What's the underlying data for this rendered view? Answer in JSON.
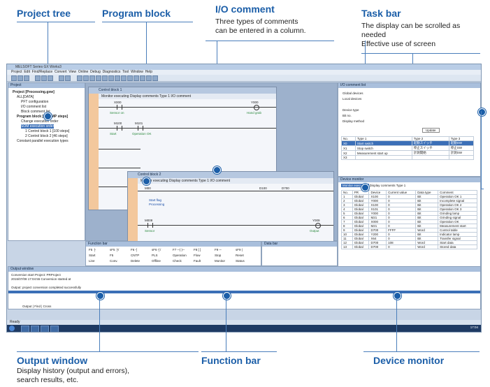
{
  "callouts": {
    "project_tree": {
      "title": "Project tree"
    },
    "program_block": {
      "title": "Program block"
    },
    "io_comment": {
      "title": "I/O comment",
      "desc": [
        "Three types of comments",
        "can be entered in a column."
      ]
    },
    "task_bar": {
      "title": "Task bar",
      "desc": [
        "The display can be scrolled as",
        "needed",
        "Effective use of screen"
      ]
    },
    "output_window": {
      "title": "Output window",
      "desc": [
        "Display history (output and errors),",
        "search results, etc."
      ]
    },
    "function_bar": {
      "title": "Function bar"
    },
    "device_monitor": {
      "title": "Device monitor"
    }
  },
  "screen": {
    "window_title": "MELSOFT Series GX Works3",
    "menu": [
      "Project",
      "Edit",
      "Find/Replace",
      "Convert",
      "View",
      "Online",
      "Debug",
      "Diagnostics",
      "Tool",
      "Window",
      "Help"
    ],
    "project_pane": {
      "header": "Project",
      "items": [
        "Project [Processing.gxw]",
        "ALL[DATA]",
        "PFT configuration",
        "I/O comment list",
        "Block comment list",
        "Program block [PA-SMP steps]",
        "Change execution order",
        "SOM execution order",
        "1 Control block 1 [100 steps]",
        "2 Control block 2 [46 steps]",
        "Constant parallel execution types"
      ],
      "selected_index": 7
    },
    "ladder_back": {
      "tabs": "Control block 1 | Control block 2",
      "title": "Control block 1",
      "controls": "Monitor executing  Display comments  Type 1  I/O comment",
      "labels": [
        "X000",
        "Y000",
        "M100",
        "M101",
        "Sensor on",
        "Hand grab",
        "Start",
        "Operation OK"
      ]
    },
    "ladder_front": {
      "title": "Control block 2",
      "controls": "Monitor executing  Display comments  Type 1  I/O comment",
      "labels": [
        "M00",
        "M008",
        "Y009",
        "D100",
        "D700",
        "Start flag",
        "Processing",
        "Output",
        "Sensor",
        "Stop"
      ]
    },
    "io_comment_pane": {
      "header": "I/O comment list",
      "fields": [
        "Global devices",
        "Local devices",
        "Device type",
        "Bit no.",
        "Display method",
        "Update"
      ],
      "columns": [
        "No.",
        "Type 1",
        "Type 2",
        "Type 3"
      ],
      "rows": [
        [
          "X0",
          "Start switch",
          "起動スイッチ",
          "起動SW"
        ],
        [
          "X1",
          "Stop switch",
          "停止スイッチ",
          "停止SW"
        ],
        [
          "X2",
          "Measurement start up",
          "計測開始",
          "計測SW"
        ],
        [
          "X3",
          "",
          "",
          ""
        ]
      ]
    },
    "device_monitor_pane": {
      "header": "Device monitor",
      "buttons": [
        "Monitor executing",
        "Display comments",
        "Type 1"
      ],
      "columns": [
        "No.",
        "PR",
        "Device",
        "Current value",
        "Data type",
        "Comment"
      ],
      "rows": [
        [
          "1",
          "Global",
          "X100",
          "0",
          "Bit",
          "Operation OK 1"
        ],
        [
          "2",
          "Global",
          "Y000",
          "0",
          "Bit",
          "Incomplete signal"
        ],
        [
          "3",
          "Global",
          "X100",
          "0",
          "Bit",
          "Operation OK 2"
        ],
        [
          "4",
          "Global",
          "X101",
          "0",
          "Bit",
          "Operation OK 3"
        ],
        [
          "5",
          "Global",
          "Y000",
          "0",
          "Bit",
          "Grinding lamp"
        ],
        [
          "6",
          "Global",
          "M21",
          "0",
          "Bit",
          "Grinding signal"
        ],
        [
          "7",
          "Global",
          "X000",
          "0",
          "Bit",
          "Operation OK"
        ],
        [
          "8",
          "Global",
          "M21",
          "0",
          "Bit",
          "Measurement start"
        ],
        [
          "9",
          "Global",
          "D700",
          "FFFF",
          "Word",
          "Control table"
        ],
        [
          "10",
          "Global",
          "Y200",
          "0",
          "Bit",
          "Indicator lamp"
        ],
        [
          "11",
          "Global",
          "X64",
          "0",
          "Bit",
          "Transfer signal"
        ],
        [
          "12",
          "Global",
          "D700",
          "108",
          "Word",
          "Start data"
        ],
        [
          "13",
          "Global",
          "D700",
          "0",
          "Word",
          "Stored data"
        ]
      ]
    },
    "function_bar_pane": {
      "header": "Function bar",
      "row1": [
        "F5 ├",
        "sF5 ├/",
        "F6 ┤",
        "sF6 ┤/",
        "F7 ─( )─",
        "F8 [ ]",
        "F9 ─",
        "sF9 |"
      ],
      "row2": [
        "Start",
        "F5",
        "CNTP",
        "PLS",
        "Operation",
        "Flow",
        "Stop",
        "Reset"
      ],
      "row3": [
        "Line",
        "Conv.",
        "Delete",
        "Offline",
        "Check",
        "Fault",
        "Monitor",
        "Status"
      ]
    },
    "data_bar_pane": {
      "header": "Data bar"
    },
    "output_pane": {
      "header": "Output window",
      "lines": [
        "Conversion start Project: PRProject",
        "2015/07/08 17:04:55 Conversion started at",
        "",
        "Output: project conversion completed successfully"
      ],
      "tabs": [
        "Output",
        "Find",
        "Cross"
      ]
    },
    "status_text": "Ready",
    "clock": "17:04"
  }
}
